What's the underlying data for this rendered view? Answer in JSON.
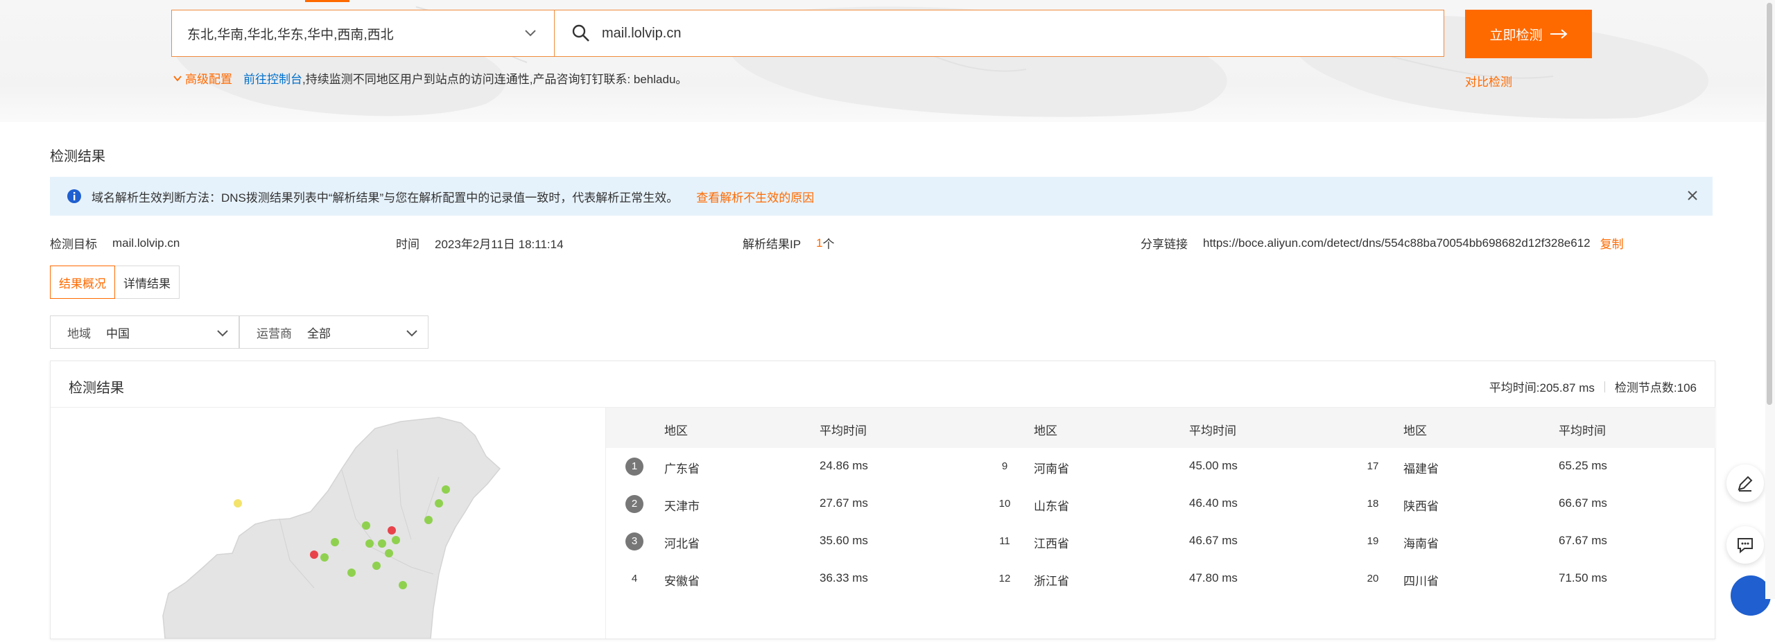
{
  "search": {
    "region_value": "东北,华南,华北,华东,华中,西南,西北",
    "domain_value": "mail.lolvip.cn",
    "detect_label": "立即检测",
    "advanced_label": "高级配置",
    "console_link": "前往控制台",
    "console_text": ",持续监测不同地区用户到站点的访问连通性,产品咨询钉钉联系: behladu。",
    "compare_label": "对比检测"
  },
  "results": {
    "section_title": "检测结果",
    "notice_text": "域名解析生效判断方法：DNS拨测结果列表中“解析结果”与您在解析配置中的记录值一致时，代表解析正常生效。",
    "notice_link": "查看解析不生效的原因",
    "target_label": "检测目标",
    "target_value": "mail.lolvip.cn",
    "time_label": "时间",
    "time_value": "2023年2月11日 18:11:14",
    "ip_label": "解析结果IP",
    "ip_count": "1",
    "ip_unit": "个",
    "share_label": "分享链接",
    "share_url": "https://boce.aliyun.com/detect/dns/554c88ba70054bb698682d12f328e612",
    "copy_label": "复制"
  },
  "tabs": [
    {
      "label": "结果概况"
    },
    {
      "label": "详情结果"
    }
  ],
  "filters": {
    "region_label": "地域",
    "region_value": "中国",
    "isp_label": "运营商",
    "isp_value": "全部"
  },
  "card": {
    "title": "检测结果",
    "avg_time": "平均时间:205.87 ms",
    "node_count": "检测节点数:106"
  },
  "table": {
    "col_region": "地区",
    "col_avg": "平均时间",
    "rows": [
      [
        {
          "rank": "1",
          "region": "广东省",
          "time": "24.86 ms"
        },
        {
          "rank": "9",
          "region": "河南省",
          "time": "45.00 ms"
        },
        {
          "rank": "17",
          "region": "福建省",
          "time": "65.25 ms"
        }
      ],
      [
        {
          "rank": "2",
          "region": "天津市",
          "time": "27.67 ms"
        },
        {
          "rank": "10",
          "region": "山东省",
          "time": "46.40 ms"
        },
        {
          "rank": "18",
          "region": "陕西省",
          "time": "66.67 ms"
        }
      ],
      [
        {
          "rank": "3",
          "region": "河北省",
          "time": "35.60 ms"
        },
        {
          "rank": "11",
          "region": "江西省",
          "time": "46.67 ms"
        },
        {
          "rank": "19",
          "region": "海南省",
          "time": "67.67 ms"
        }
      ],
      [
        {
          "rank": "4",
          "region": "安徽省",
          "time": "36.33 ms"
        },
        {
          "rank": "12",
          "region": "浙江省",
          "time": "47.80 ms"
        },
        {
          "rank": "20",
          "region": "四川省",
          "time": "71.50 ms"
        }
      ]
    ]
  },
  "colors": {
    "accent": "#ff6a00",
    "link_blue": "#0070cc",
    "notice_bg": "#e6f2fb",
    "node_green": "#8fd14f",
    "node_red": "#e8434b",
    "node_yellow": "#f3e36b"
  }
}
